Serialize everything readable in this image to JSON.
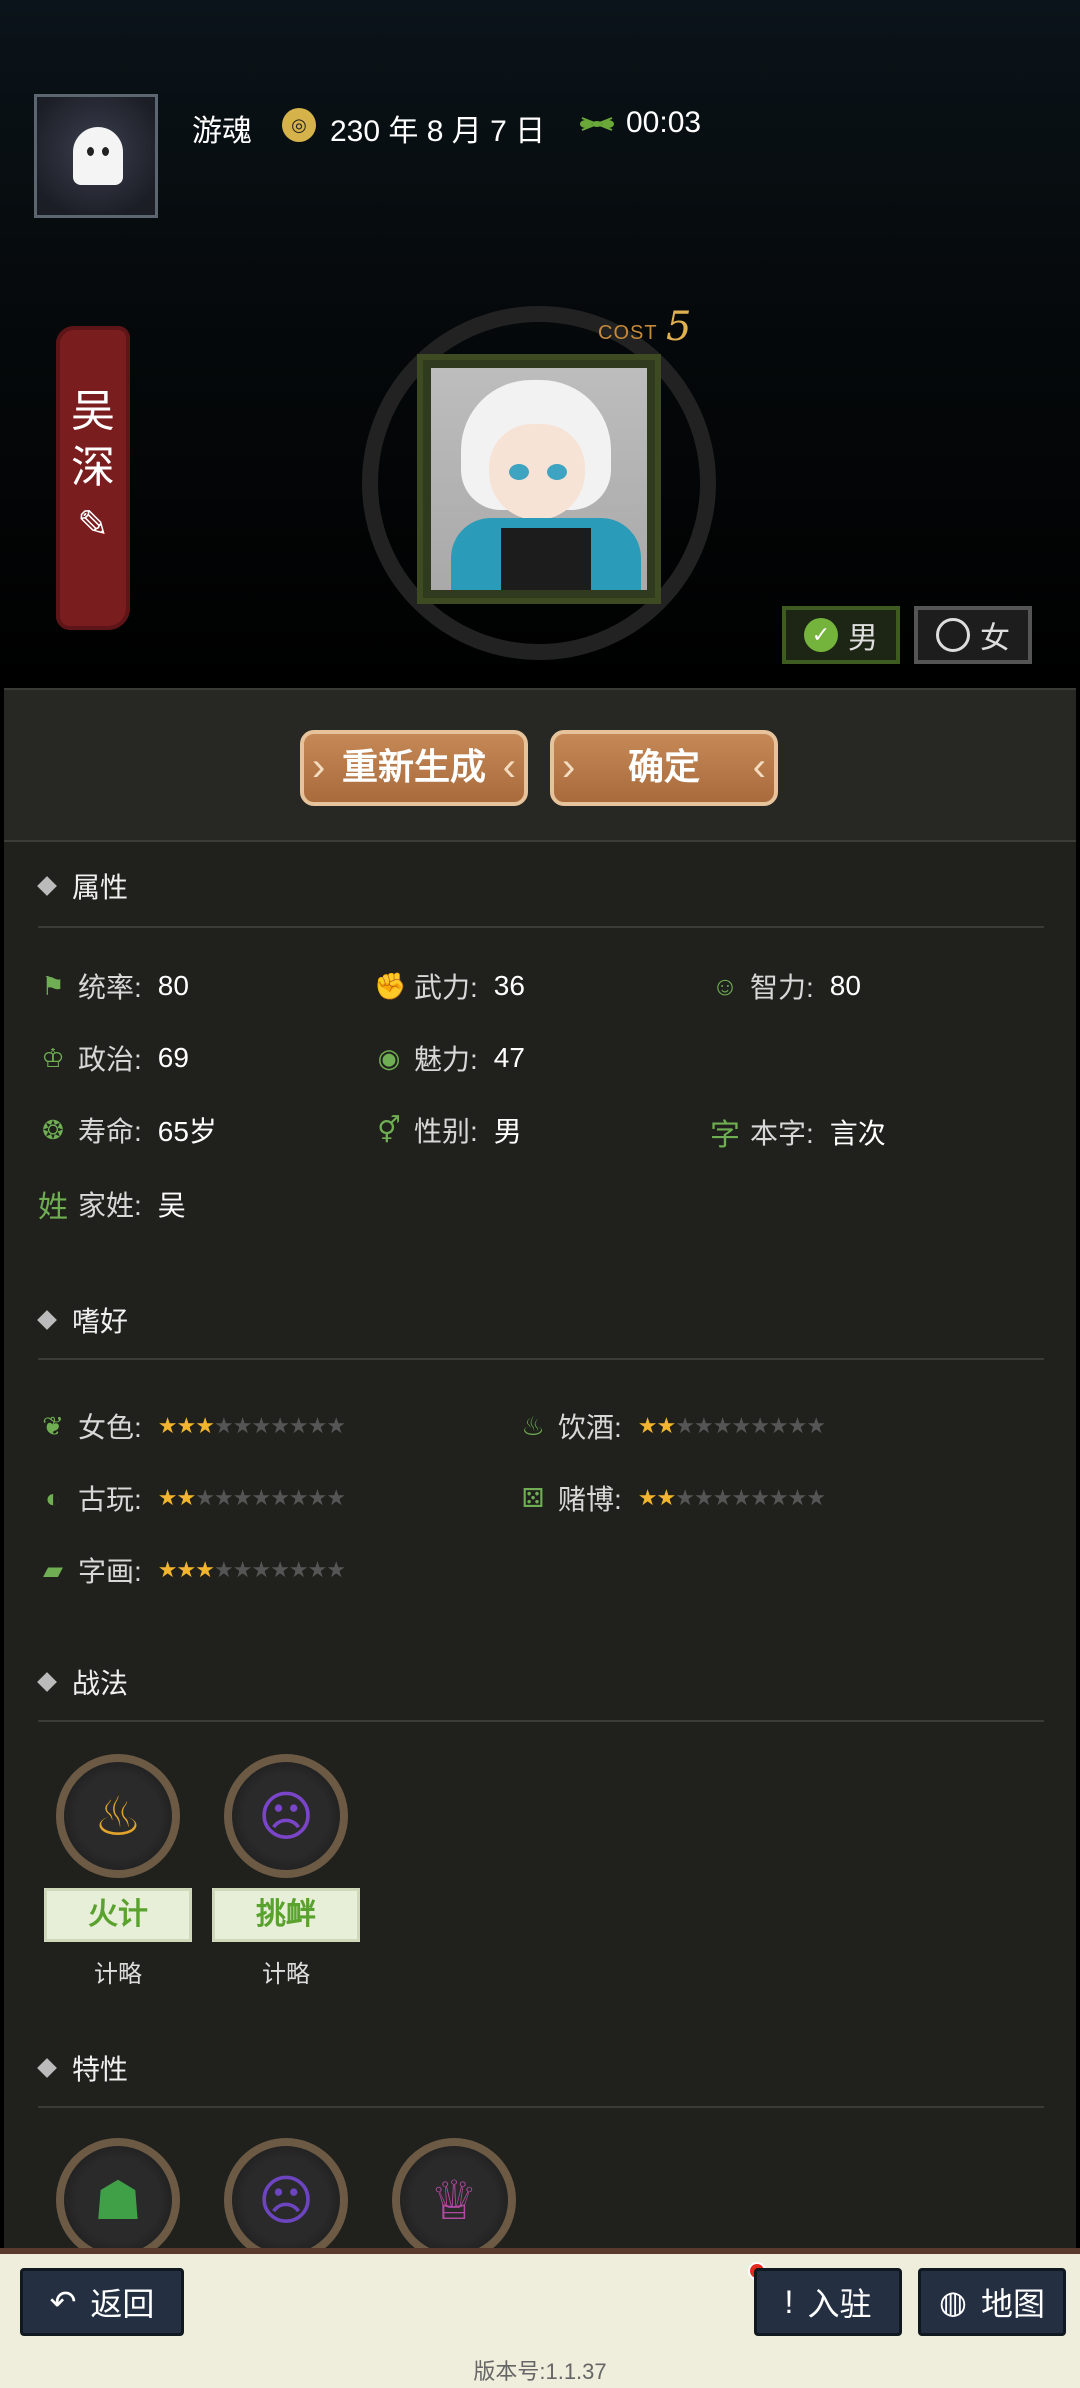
{
  "header": {
    "player_name": "游魂",
    "date_icon": "calendar-seal-icon",
    "date": "230 年 8 月 7 日",
    "time_icon": "ant-icon",
    "time": "00:03"
  },
  "character": {
    "name_chars": [
      "吴",
      "深"
    ],
    "cost_label": "COST",
    "cost_value": "5",
    "gender_male": "男",
    "gender_female": "女",
    "selected_gender": "male"
  },
  "actions": {
    "regenerate": "重新生成",
    "confirm": "确定"
  },
  "attributes": {
    "title": "属性",
    "items": [
      {
        "label": "统率:",
        "value": "80",
        "icon": "flag-icon"
      },
      {
        "label": "武力:",
        "value": "36",
        "icon": "arm-icon"
      },
      {
        "label": "智力:",
        "value": "80",
        "icon": "brain-icon"
      },
      {
        "label": "政治:",
        "value": "69",
        "icon": "crown-icon"
      },
      {
        "label": "魅力:",
        "value": "47",
        "icon": "eye-icon"
      },
      {
        "label": "寿命:",
        "value": "65岁",
        "icon": "seal-icon"
      },
      {
        "label": "性别:",
        "value": "男",
        "icon": "gender-icon"
      },
      {
        "label": "本字:",
        "value": "言次",
        "icon": "字"
      },
      {
        "label": "家姓:",
        "value": "吴",
        "icon": "姓"
      }
    ]
  },
  "hobbies": {
    "title": "嗜好",
    "items": [
      {
        "label": "女色:",
        "stars": 3,
        "max": 10,
        "icon": "sandals-icon"
      },
      {
        "label": "饮酒:",
        "stars": 2,
        "max": 10,
        "icon": "bottle-icon"
      },
      {
        "label": "古玩:",
        "stars": 1.5,
        "max": 10,
        "icon": "orb-icon"
      },
      {
        "label": "赌博:",
        "stars": 1.5,
        "max": 10,
        "icon": "dice-icon"
      },
      {
        "label": "字画:",
        "stars": 2.5,
        "max": 10,
        "icon": "scroll-icon"
      }
    ]
  },
  "tactics": {
    "title": "战法",
    "items": [
      {
        "name": "火计",
        "type": "计略",
        "icon": "fire-icon"
      },
      {
        "name": "挑衅",
        "type": "计略",
        "icon": "taunt-icon"
      }
    ]
  },
  "traits": {
    "title": "特性",
    "icons": [
      "kneel-icon",
      "angry-face-icon",
      "toast-icon"
    ]
  },
  "footer": {
    "back": "返回",
    "settle": "入驻",
    "map": "地图",
    "version": "版本号:1.1.37"
  }
}
